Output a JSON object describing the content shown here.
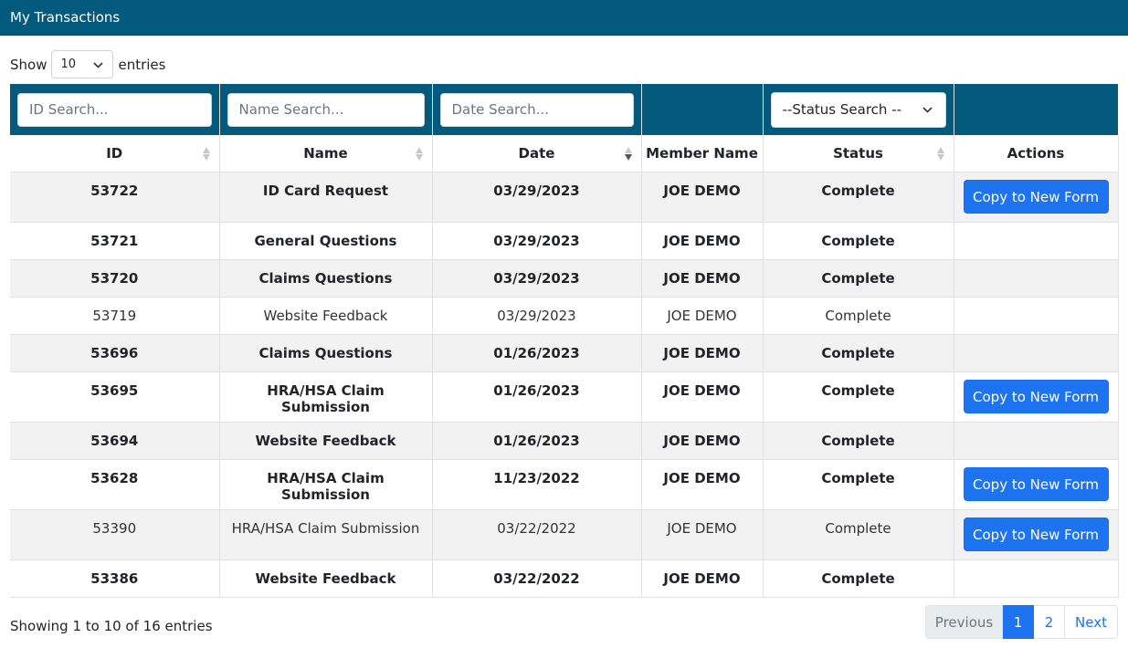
{
  "header": {
    "title": "My Transactions"
  },
  "length_menu": {
    "prefix": "Show",
    "value": "10",
    "suffix": "entries"
  },
  "filters": {
    "id_placeholder": "ID Search...",
    "name_placeholder": "Name Search...",
    "date_placeholder": "Date Search...",
    "status_value": "--Status Search --"
  },
  "columns": [
    "ID",
    "Name",
    "Date",
    "Member Name",
    "Status",
    "Actions"
  ],
  "rows": [
    {
      "id": "53722",
      "name": "ID Card Request",
      "date": "03/29/2023",
      "member": "JOE DEMO",
      "status": "Complete",
      "action": "Copy to New Form"
    },
    {
      "id": "53721",
      "name": "General Questions",
      "date": "03/29/2023",
      "member": "JOE DEMO",
      "status": "Complete",
      "action": ""
    },
    {
      "id": "53720",
      "name": "Claims Questions",
      "date": "03/29/2023",
      "member": "JOE DEMO",
      "status": "Complete",
      "action": ""
    },
    {
      "id": "53719",
      "name": "Website Feedback",
      "date": "03/29/2023",
      "member": "JOE DEMO",
      "status": "Complete",
      "action": ""
    },
    {
      "id": "53696",
      "name": "Claims Questions",
      "date": "01/26/2023",
      "member": "JOE DEMO",
      "status": "Complete",
      "action": ""
    },
    {
      "id": "53695",
      "name": "HRA/HSA Claim Submission",
      "date": "01/26/2023",
      "member": "JOE DEMO",
      "status": "Complete",
      "action": "Copy to New Form"
    },
    {
      "id": "53694",
      "name": "Website Feedback",
      "date": "01/26/2023",
      "member": "JOE DEMO",
      "status": "Complete",
      "action": ""
    },
    {
      "id": "53628",
      "name": "HRA/HSA Claim Submission",
      "date": "11/23/2022",
      "member": "JOE DEMO",
      "status": "Complete",
      "action": "Copy to New Form"
    },
    {
      "id": "53390",
      "name": "HRA/HSA Claim Submission",
      "date": "03/22/2022",
      "member": "JOE DEMO",
      "status": "Complete",
      "action": "Copy to New Form"
    },
    {
      "id": "53386",
      "name": "Website Feedback",
      "date": "03/22/2022",
      "member": "JOE DEMO",
      "status": "Complete",
      "action": ""
    }
  ],
  "footer": {
    "info": "Showing 1 to 10 of 16 entries",
    "previous": "Previous",
    "page1": "1",
    "page2": "2",
    "next": "Next"
  }
}
